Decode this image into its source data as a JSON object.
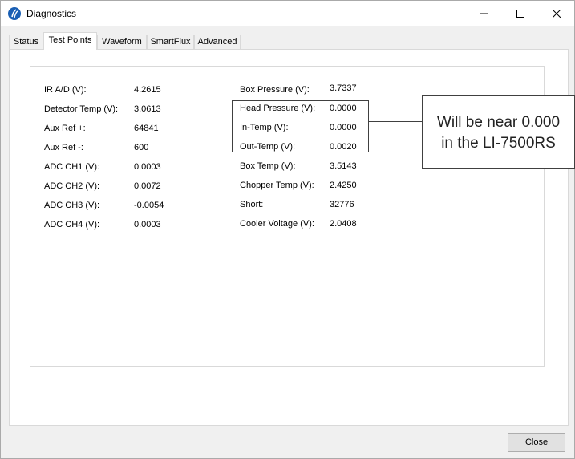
{
  "window": {
    "title": "Diagnostics"
  },
  "tabs": [
    {
      "label": "Status"
    },
    {
      "label": "Test Points"
    },
    {
      "label": "Waveform"
    },
    {
      "label": "SmartFlux"
    },
    {
      "label": "Advanced"
    }
  ],
  "active_tab": "Test Points",
  "left_readings": [
    {
      "label": "IR A/D (V):",
      "value": "4.2615"
    },
    {
      "label": "Detector Temp (V):",
      "value": "3.0613"
    },
    {
      "label": "Aux Ref +:",
      "value": "64841"
    },
    {
      "label": "Aux Ref -:",
      "value": "600"
    },
    {
      "label": "ADC CH1 (V):",
      "value": "0.0003"
    },
    {
      "label": "ADC CH2 (V):",
      "value": "0.0072"
    },
    {
      "label": "ADC CH3 (V):",
      "value": "-0.0054"
    },
    {
      "label": "ADC CH4 (V):",
      "value": "0.0003"
    }
  ],
  "right_readings": [
    {
      "label": "Box Pressure (V):",
      "value": "3.7337"
    },
    {
      "label": "Head Pressure (V):",
      "value": "0.0000"
    },
    {
      "label": "In-Temp (V):",
      "value": "0.0000"
    },
    {
      "label": "Out-Temp (V):",
      "value": "0.0020"
    },
    {
      "label": "Box Temp (V):",
      "value": "3.5143"
    },
    {
      "label": "Chopper Temp (V):",
      "value": "2.4250"
    },
    {
      "label": "Short:",
      "value": "32776"
    },
    {
      "label": "Cooler Voltage (V):",
      "value": "2.0408"
    }
  ],
  "callout": {
    "line1": "Will be near 0.000",
    "line2": "in the LI-7500RS"
  },
  "buttons": {
    "close_label": "Close"
  },
  "icons": {
    "app": "licor-app-icon",
    "minimize": "minimize-icon",
    "maximize": "maximize-icon",
    "close": "close-icon"
  },
  "colors": {
    "accent": "#1a5fb4",
    "callout_border": "#404040"
  }
}
